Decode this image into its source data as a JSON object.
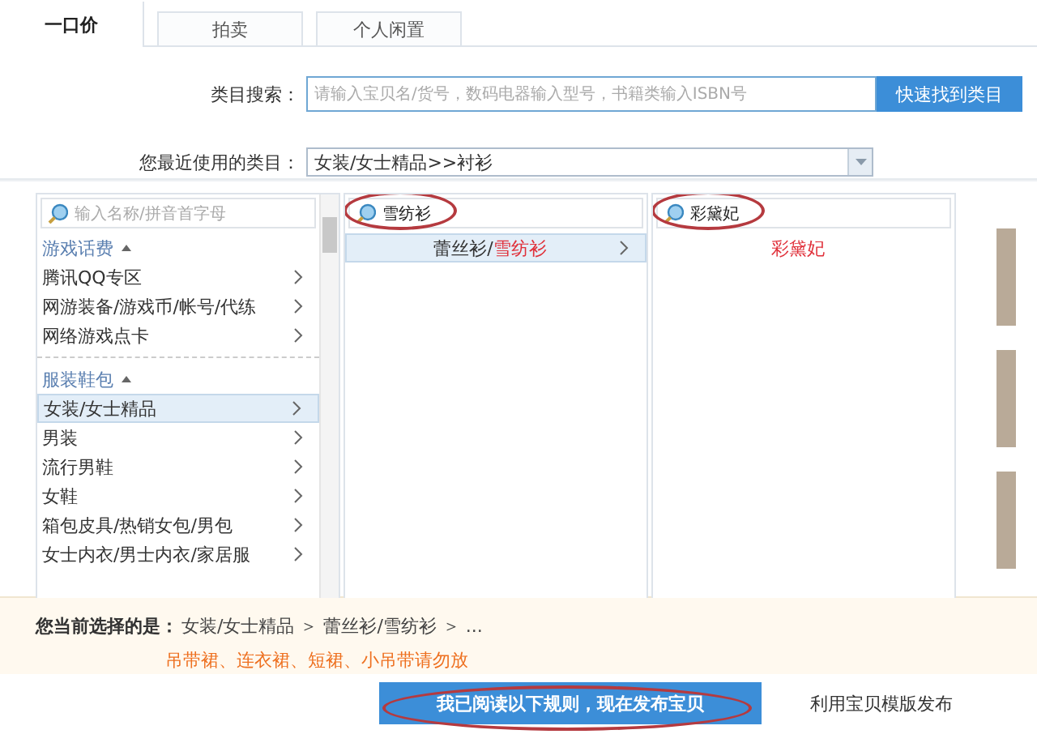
{
  "tabs": [
    {
      "label": "一口价",
      "selected": true
    },
    {
      "label": "拍卖",
      "selected": false
    },
    {
      "label": "个人闲置",
      "selected": false
    }
  ],
  "category_search": {
    "label": "类目搜索：",
    "placeholder": "请输入宝贝名/货号，数码电器输入型号，书籍类输入ISBN号",
    "button": "快速找到类目"
  },
  "recent_category": {
    "label": "您最近使用的类目：",
    "value": "女装/女士精品>>衬衫"
  },
  "columns": [
    {
      "search": {
        "placeholder": "输入名称/拼音首字母",
        "highlighted": false
      },
      "groups": [
        {
          "title": "游戏话费",
          "expanded": true,
          "items": [
            {
              "label": "腾讯QQ专区",
              "selected": false,
              "has_children": true
            },
            {
              "label": "网游装备/游戏币/帐号/代练",
              "selected": false,
              "has_children": true
            },
            {
              "label": "网络游戏点卡",
              "selected": false,
              "has_children": true
            }
          ]
        },
        {
          "title": "服装鞋包",
          "expanded": true,
          "items": [
            {
              "label": "女装/女士精品",
              "selected": true,
              "has_children": true
            },
            {
              "label": "男装",
              "selected": false,
              "has_children": true
            },
            {
              "label": "流行男鞋",
              "selected": false,
              "has_children": true
            },
            {
              "label": "女鞋",
              "selected": false,
              "has_children": true
            },
            {
              "label": "箱包皮具/热销女包/男包",
              "selected": false,
              "has_children": true
            },
            {
              "label": "女士内衣/男士内衣/家居服",
              "selected": false,
              "has_children": true
            }
          ]
        }
      ]
    },
    {
      "search": {
        "value": "雪纺衫",
        "highlighted": true
      },
      "groups": [
        {
          "items": [
            {
              "label": "蕾丝衫/",
              "match": "雪纺衫",
              "selected": true,
              "has_children": true
            }
          ]
        }
      ]
    },
    {
      "search": {
        "value": "彩黛妃",
        "highlighted": true
      },
      "groups": [
        {
          "items": [
            {
              "match": "彩黛妃",
              "selected": false,
              "has_children": false
            }
          ]
        }
      ]
    }
  ],
  "selection": {
    "label": "您当前选择的是：",
    "path": "女装/女士精品 ＞ 蕾丝衫/雪纺衫 ＞ ...",
    "warning": "吊带裙、连衣裙、短裙、小吊带请勿放"
  },
  "publish_button": {
    "label": "我已阅读以下规则，现在发布宝贝",
    "highlighted": true
  },
  "template_link": "利用宝贝模版发布"
}
